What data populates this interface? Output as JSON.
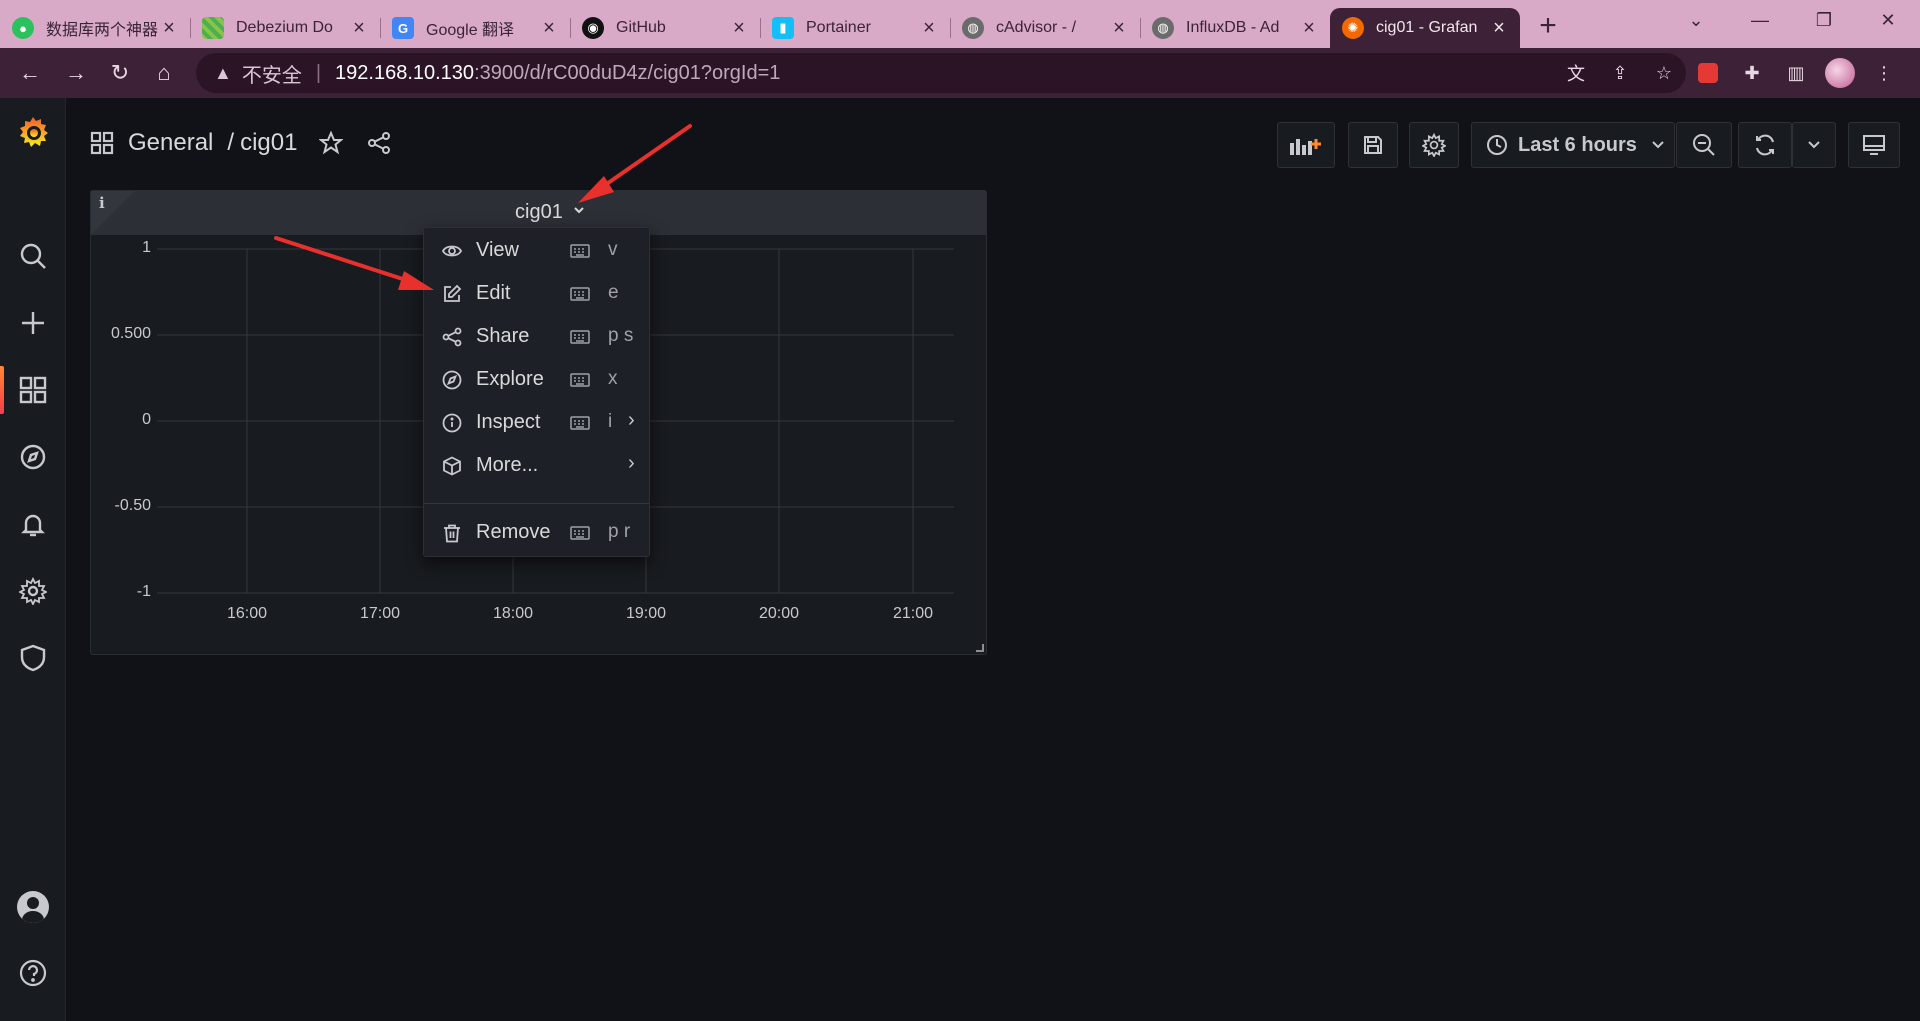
{
  "browser": {
    "tabs": [
      {
        "title": "数据库两个神器",
        "icon": "wechat-icon",
        "color": "#2bc15d",
        "active": false
      },
      {
        "title": "Debezium Do",
        "icon": "debezium-icon",
        "color": "#8bc34a",
        "active": false
      },
      {
        "title": "Google 翻译",
        "icon": "google-translate-icon",
        "color": "#4285f4",
        "active": false
      },
      {
        "title": "GitHub",
        "icon": "github-icon",
        "color": "#111111",
        "active": false
      },
      {
        "title": "Portainer",
        "icon": "portainer-icon",
        "color": "#13bef9",
        "active": false
      },
      {
        "title": "cAdvisor - /",
        "icon": "globe-icon",
        "color": "#6b6b6b",
        "active": false
      },
      {
        "title": "InfluxDB - Ad",
        "icon": "globe-icon",
        "color": "#6b6b6b",
        "active": false
      },
      {
        "title": "cig01 - Grafan",
        "icon": "grafana-icon",
        "color": "#f46800",
        "active": true
      }
    ],
    "url_insecure_label": "不安全",
    "url_host": "192.168.10.130",
    "url_path": ":3900/d/rC00duD4z/cig01?orgId=1"
  },
  "dashboard": {
    "folder": "General",
    "separator": "/",
    "title": "cig01",
    "time_range": "Last 6 hours",
    "panel": {
      "title": "cig01",
      "info_icon": "i"
    }
  },
  "chart_data": {
    "type": "line",
    "title": "cig01",
    "series": [],
    "x_ticks": [
      "16:00",
      "17:00",
      "18:00",
      "19:00",
      "20:00",
      "21:00"
    ],
    "y_ticks": [
      "1",
      "0.500",
      "0",
      "-0.50",
      "-1"
    ],
    "ylim": [
      -1,
      1
    ],
    "grid": true
  },
  "panel_menu": {
    "items": [
      {
        "label": "View",
        "icon": "eye-icon",
        "shortcut": "v",
        "submenu": false
      },
      {
        "label": "Edit",
        "icon": "edit-icon",
        "shortcut": "e",
        "submenu": false
      },
      {
        "label": "Share",
        "icon": "share-icon",
        "shortcut": "p s",
        "submenu": false
      },
      {
        "label": "Explore",
        "icon": "compass-icon",
        "shortcut": "x",
        "submenu": false
      },
      {
        "label": "Inspect",
        "icon": "info-circle-icon",
        "shortcut": "i",
        "submenu": true
      },
      {
        "label": "More...",
        "icon": "cube-icon",
        "shortcut": "",
        "submenu": true
      },
      {
        "label": "Remove",
        "icon": "trash-icon",
        "shortcut": "p r",
        "submenu": false
      }
    ]
  },
  "colors": {
    "accent": "#ff8833",
    "annotation_arrow": "#e8312c",
    "background": "#111217",
    "panel": "#181b1f"
  }
}
